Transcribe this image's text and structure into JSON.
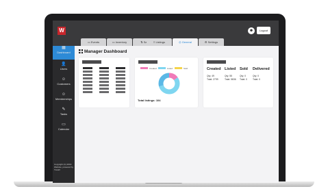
{
  "app": {
    "logo_letter": "W",
    "logout_label": "Logout",
    "avatar_glyph": "☻"
  },
  "tabs": [
    {
      "label": "Events",
      "icon": "calendar-icon"
    },
    {
      "label": "Inventory",
      "icon": "monitor-icon"
    },
    {
      "label": "Sales",
      "icon": "sales-icon"
    },
    {
      "label": "Listings",
      "icon": "list-icon"
    },
    {
      "label": "General",
      "icon": "globe-icon",
      "active": true
    },
    {
      "label": "Settings",
      "icon": "settings-icon"
    }
  ],
  "sidebar": {
    "items": [
      {
        "label": "Dashboard",
        "icon": "grid-icon",
        "glyph": "▦",
        "active": true
      },
      {
        "label": "Users",
        "icon": "user-icon",
        "glyph": "👤"
      },
      {
        "label": "Customers",
        "icon": "customers-icon",
        "glyph": "☺"
      },
      {
        "label": "Memberships",
        "icon": "membership-icon",
        "glyph": "☺"
      },
      {
        "label": "Tasks",
        "icon": "tasks-icon",
        "glyph": "✎"
      },
      {
        "label": "Calendar",
        "icon": "calendar-icon",
        "glyph": "▭"
      }
    ],
    "copyright": "Copyright (C) 2019 Website, powered by TH-EV"
  },
  "main": {
    "title": "Manager Dashboard",
    "legend": [
      {
        "label": "Created",
        "color": "#f07ab8"
      },
      {
        "label": "Listed",
        "color": "#7fd6f0"
      },
      {
        "label": "Sold",
        "color": "#f5d44a"
      }
    ],
    "donut": {
      "created": 0.15,
      "listed": 0.55,
      "sold": 0.3,
      "colors": [
        "#f07ab8",
        "#7fd6f0",
        "#5ab8e6"
      ]
    },
    "total_listings": "Total listings: 104",
    "stats": {
      "headers": [
        "Created",
        "Listed",
        "Sold",
        "Delivered"
      ],
      "created": {
        "qty": "Qty: 49",
        "total": "Total: 2799"
      },
      "listed": {
        "qty": "Qty: 55",
        "total": "Total: 5836"
      },
      "sold": {
        "qty": "Qty: 0",
        "total": "Total: 0"
      },
      "delivered": {
        "qty": "Qty: 0",
        "total": "Total: 0"
      }
    }
  }
}
